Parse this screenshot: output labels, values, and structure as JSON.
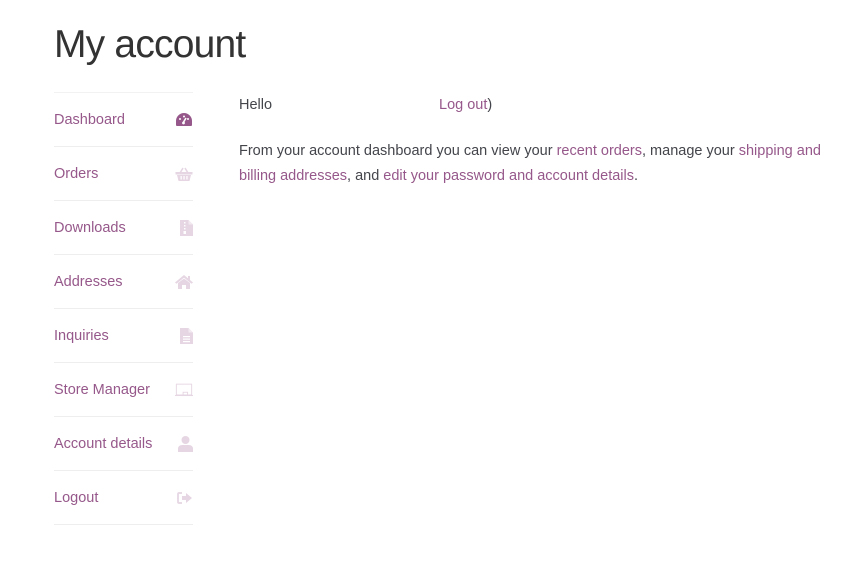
{
  "page": {
    "title": "My account"
  },
  "colors": {
    "accent": "#96588a",
    "icon_inactive": "#e6d6e3",
    "text": "#43454b"
  },
  "nav": {
    "items": [
      {
        "label": "Dashboard",
        "icon": "dashboard-gauge-icon",
        "active": true
      },
      {
        "label": "Orders",
        "icon": "basket-icon",
        "active": false
      },
      {
        "label": "Downloads",
        "icon": "file-archive-icon",
        "active": false
      },
      {
        "label": "Addresses",
        "icon": "home-icon",
        "active": false
      },
      {
        "label": "Inquiries",
        "icon": "file-text-icon",
        "active": false
      },
      {
        "label": "Store Manager",
        "icon": "store-manager-icon",
        "active": false
      },
      {
        "label": "Account details",
        "icon": "user-icon",
        "active": false
      },
      {
        "label": "Logout",
        "icon": "sign-out-icon",
        "active": false
      }
    ]
  },
  "dashboard": {
    "hello": "Hello",
    "logout_link": "Log out",
    "logout_suffix": ")",
    "intro_prefix": "From your account dashboard you can view your ",
    "recent_orders_link": "recent orders",
    "intro_mid1": ", manage your ",
    "addresses_link": "shipping and billing addresses",
    "intro_mid2": ", and ",
    "account_link": "edit your password and account details",
    "intro_suffix": "."
  }
}
